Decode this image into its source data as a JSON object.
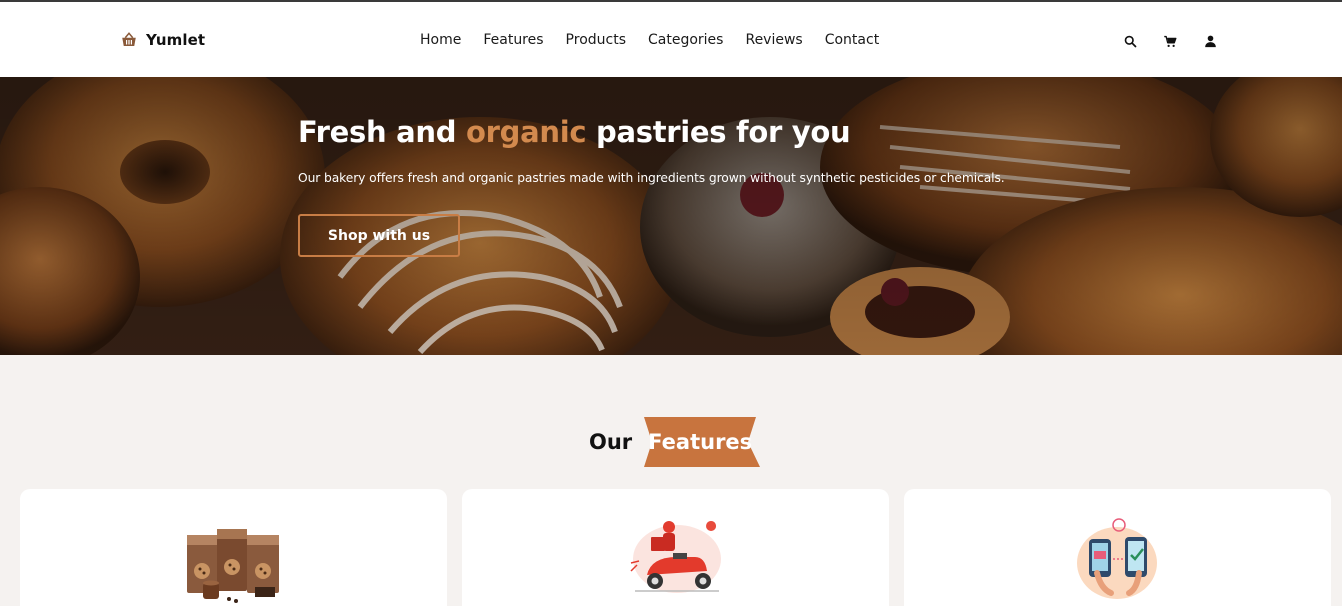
{
  "brand": {
    "name": "Yumlet",
    "icon": "basket-icon"
  },
  "nav": {
    "links": [
      "Home",
      "Features",
      "Products",
      "Categories",
      "Reviews",
      "Contact"
    ],
    "icons": [
      "search-icon",
      "cart-icon",
      "user-icon"
    ]
  },
  "hero": {
    "title_before": "Fresh and ",
    "title_accent": "organic",
    "title_after": " pastries for you",
    "subtitle": "Our bakery offers fresh and organic pastries made with ingredients grown without synthetic pesticides or chemicals.",
    "button_label": "Shop with us"
  },
  "features": {
    "heading_plain": "Our",
    "heading_badge": "Features",
    "cards": [
      {
        "illustration": "cookie-packages-illustration"
      },
      {
        "illustration": "delivery-scooter-illustration"
      },
      {
        "illustration": "mobile-payment-illustration"
      }
    ]
  },
  "colors": {
    "accent": "#d38a4e",
    "button_border": "#c87d45",
    "badge": "#c8743e",
    "section_bg": "#f5f2f0",
    "card_bg": "#ffffff"
  }
}
